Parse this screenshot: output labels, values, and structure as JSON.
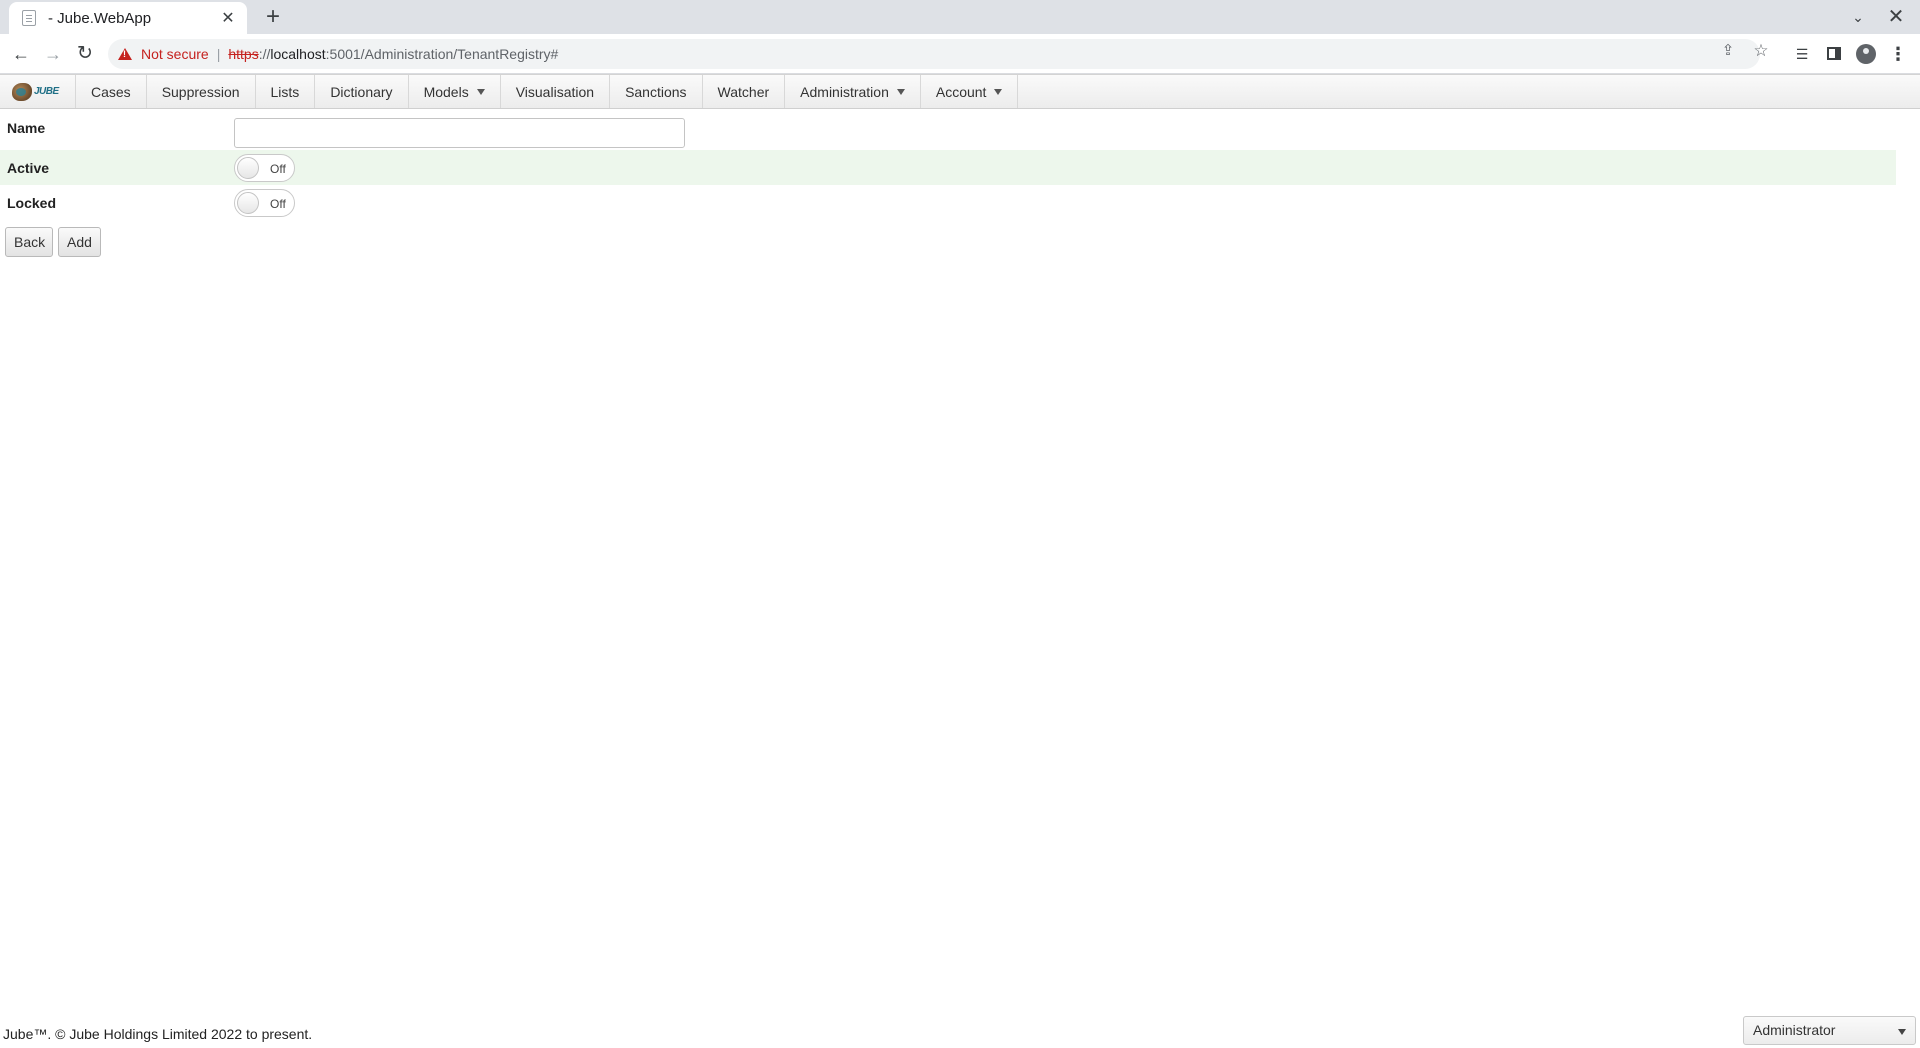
{
  "browser": {
    "tab_title": "- Jube.WebApp",
    "tab_close": "✕",
    "new_tab": "+",
    "minimize_chevron": "⌄",
    "window_close": "✕",
    "security_label": "Not secure",
    "url_scheme": "https",
    "url_sep": "://",
    "url_host": "localhost",
    "url_path": ":5001/Administration/TenantRegistry#"
  },
  "nav": {
    "logo_text": "JUBE",
    "items": [
      {
        "label": "Cases",
        "dropdown": false
      },
      {
        "label": "Suppression",
        "dropdown": false
      },
      {
        "label": "Lists",
        "dropdown": false
      },
      {
        "label": "Dictionary",
        "dropdown": false
      },
      {
        "label": "Models",
        "dropdown": true
      },
      {
        "label": "Visualisation",
        "dropdown": false
      },
      {
        "label": "Sanctions",
        "dropdown": false
      },
      {
        "label": "Watcher",
        "dropdown": false
      },
      {
        "label": "Administration",
        "dropdown": true
      },
      {
        "label": "Account",
        "dropdown": true
      }
    ]
  },
  "form": {
    "name_label": "Name",
    "name_value": "",
    "active_label": "Active",
    "active_state": "Off",
    "locked_label": "Locked",
    "locked_state": "Off",
    "back_label": "Back",
    "add_label": "Add"
  },
  "footer": {
    "copyright": "Jube™. © Jube Holdings Limited 2022 to present.",
    "role_selected": "Administrator"
  },
  "colors": {
    "active_row_bg": "#edf7ec",
    "not_secure": "#c5221f"
  }
}
